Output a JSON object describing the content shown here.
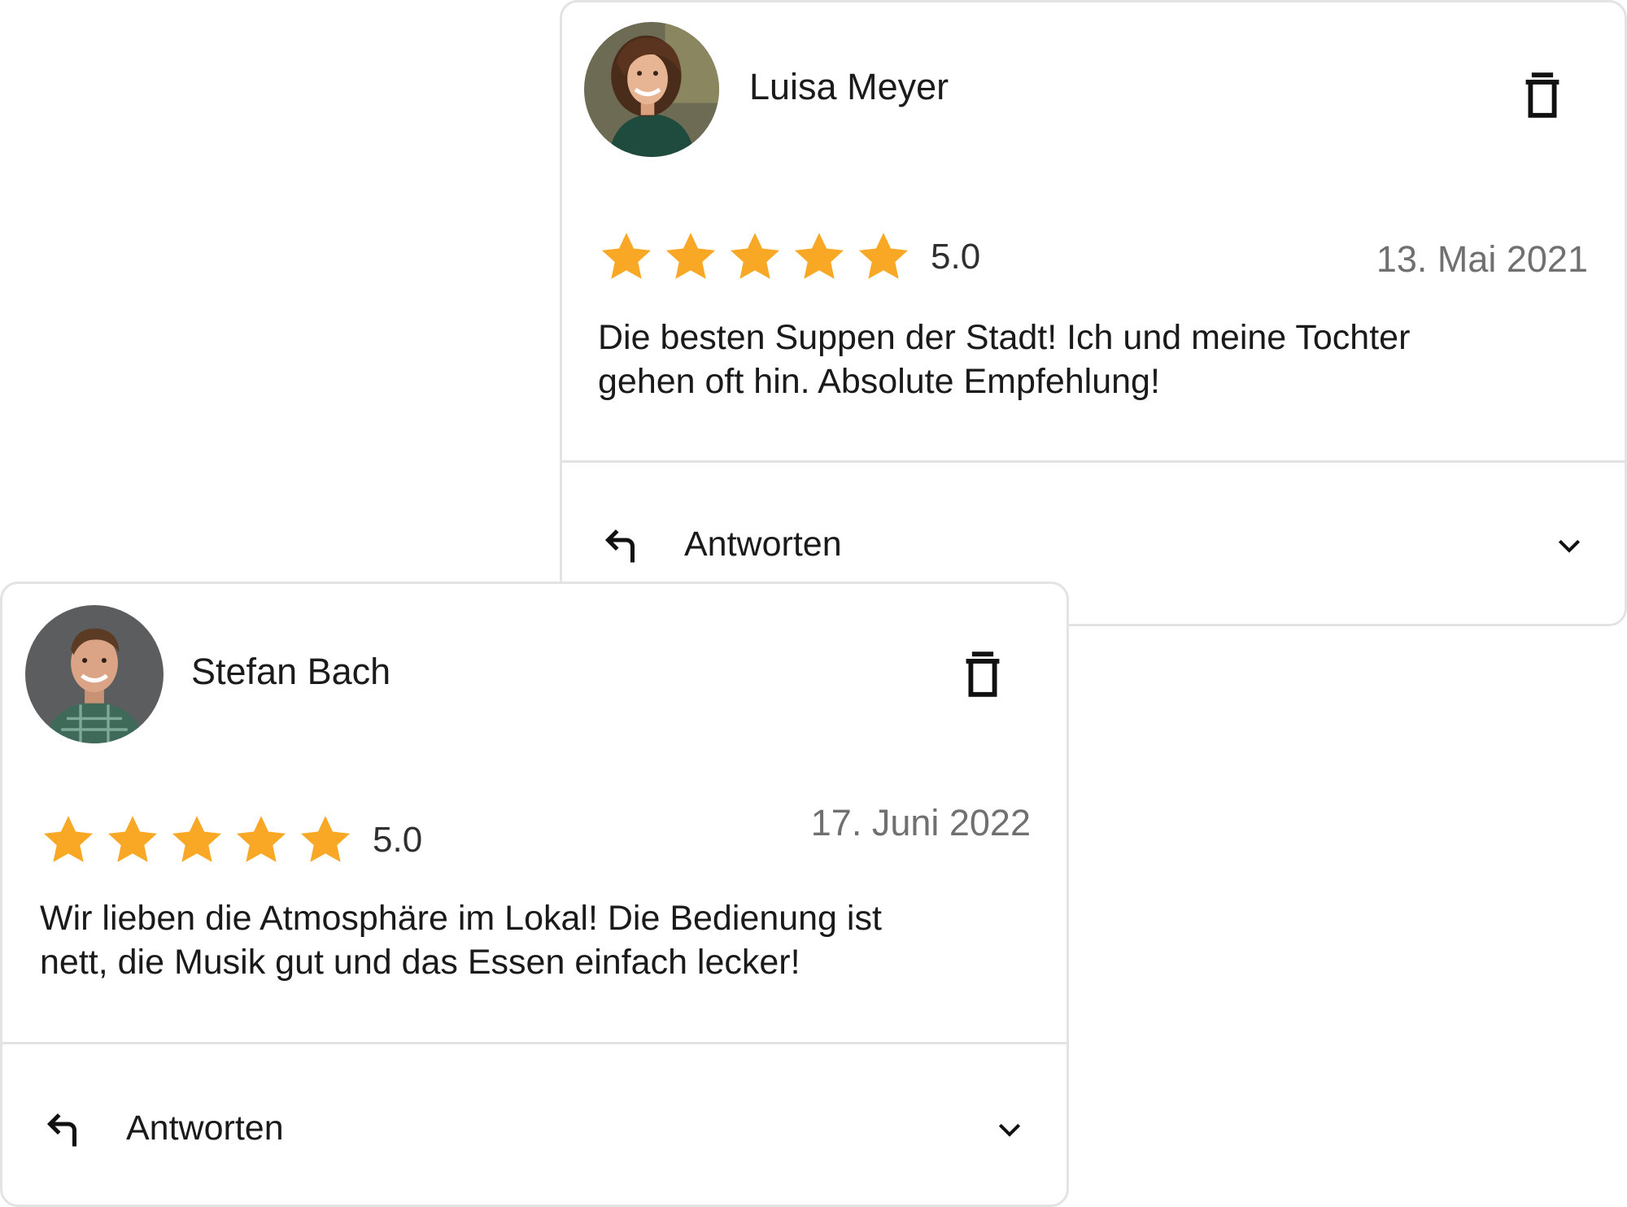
{
  "colors": {
    "star": "#F9A825",
    "card_border": "#E3E3E3",
    "date_text": "#707070"
  },
  "reviews": [
    {
      "name": "Luisa Meyer",
      "rating": 5,
      "rating_label": "5.0",
      "date": "13. Mai 2021",
      "text": "Die besten Suppen der Stadt! Ich und meine Tochter gehen oft hin. Absolute Empfehlung!",
      "reply_label": "Antworten",
      "icons": {
        "delete": "trash-icon",
        "reply": "reply-arrow-icon",
        "expand": "chevron-down-icon",
        "star": "star-icon"
      }
    },
    {
      "name": "Stefan Bach",
      "rating": 5,
      "rating_label": "5.0",
      "date": "17. Juni 2022",
      "text": "Wir lieben die Atmosphäre im Lokal! Die Bedienung ist nett, die Musik gut und das Essen einfach lecker!",
      "reply_label": "Antworten",
      "icons": {
        "delete": "trash-icon",
        "reply": "reply-arrow-icon",
        "expand": "chevron-down-icon",
        "star": "star-icon"
      }
    }
  ]
}
